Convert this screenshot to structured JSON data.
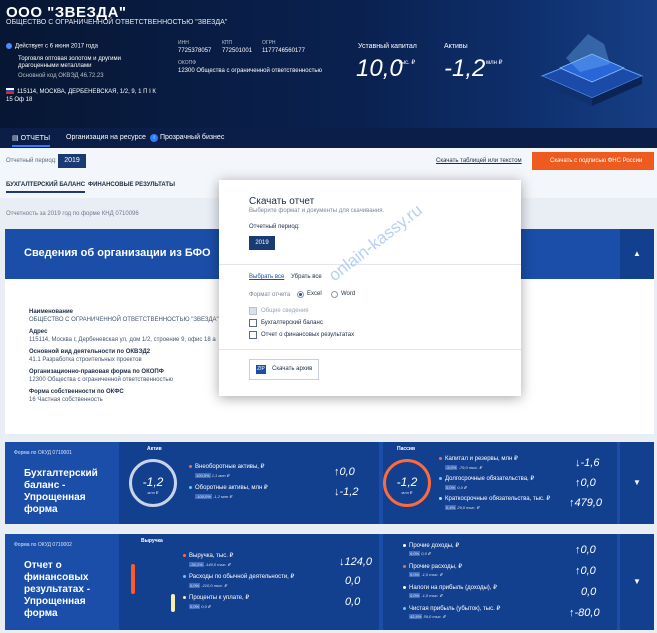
{
  "header": {
    "company_name": "ООО \"ЗВЕЗДА\"",
    "full_name": "ОБЩЕСТВО С ОГРАНИЧЕННОЙ ОТВЕТСТВЕННОСТЬЮ \"ЗВЕЗДА\"",
    "status": "Действует с 6 июня 2017 года",
    "okved_text": "Торговля оптовая золотом и другими драгоценными металлами",
    "okved_code": "Основной код ОКВЭД 46.72.23",
    "address": "115114, МОСКВА, ДЕРБЕНЕВСКАЯ, 1/2, 9, 1 П I К 15 Оф 18",
    "inn_label": "ИНН",
    "inn_value": "7725378057",
    "kpp_label": "КПП",
    "kpp_value": "772501001",
    "ogrn_label": "ОГРН",
    "ogrn_value": "1177746560177",
    "okopf_label": "ОКОПФ",
    "okopf_value": "12300 Общества с ограниченной ответственностью",
    "capital_label": "Уставный капитал",
    "capital_value": "10,0",
    "capital_unit": "тыс. ₽",
    "assets_label": "Активы",
    "assets_value": "-1,2",
    "assets_unit": "млн ₽"
  },
  "tabs": [
    "ОТЧЕТЫ",
    "Организация на ресурсе",
    "Прозрачный бизнес"
  ],
  "toolbar": {
    "period_label": "Отчетный период:",
    "period_value": "2019",
    "download_link": "Скачать таблицей или текстом",
    "signed_button": "Скачать с подписью ФНС России"
  },
  "subtabs": [
    "БУХГАЛТЕРСКИЙ БАЛАНС",
    "ФИНАНСОВЫЕ РЕЗУЛЬТАТЫ"
  ],
  "report_note": "Отчетность за 2019 год по форме КНД 0710096",
  "bfo": {
    "title": "Сведения об организации из БФО",
    "fields": [
      {
        "label": "Наименование",
        "value": "ОБЩЕСТВО С ОГРАНИЧЕННОЙ ОТВЕТСТВЕННОСТЬЮ \"ЗВЕЗДА\""
      },
      {
        "label": "Адрес",
        "value": "115114, Москва г, Дербеневская ул, дом 1/2, строение 9, офис 18 а"
      },
      {
        "label": "Основной вид деятельности по ОКВЭД2",
        "value": "41.1 Разработка строительных проектов"
      },
      {
        "label": "Организационно-правовая форма по ОКОПФ",
        "value": "12300 Общества с ограниченной ответственностью"
      },
      {
        "label": "Форма собственности по ОКФС",
        "value": "16 Частная собственность"
      }
    ]
  },
  "balance_card": {
    "form_label": "Форма по ОКУД 0710001",
    "title": "Бухгалтерский баланс - Упрощенная форма",
    "assets": {
      "title": "Актив",
      "ring_value": "-1,2",
      "ring_unit": "млн ₽",
      "rows": [
        {
          "label": "Внеоборотные активы, ₽",
          "sub": "100,0%",
          "sub2": "1,1 млн ₽",
          "value": "0,0",
          "arrow": "↑"
        },
        {
          "label": "Оборотные активы, млн ₽",
          "sub": "-100,0%",
          "sub2": "-1,2 млн ₽",
          "value": "-1,2",
          "arrow": "↓"
        }
      ]
    },
    "liabilities": {
      "title": "Пассив",
      "ring_value": "-1,2",
      "ring_unit": "млн ₽",
      "rows": [
        {
          "label": "Капитал и резервы, млн ₽",
          "sub": "-5,0%",
          "sub2": "-79,0 тыс. ₽",
          "value": "-1,6",
          "arrow": "↓"
        },
        {
          "label": "Долгосрочные обязательства, ₽",
          "sub": "0,0%",
          "sub2": "0,0 ₽",
          "value": "0,0",
          "arrow": "↑"
        },
        {
          "label": "Краткосрочные обязательства, тыс. ₽",
          "sub": "0,4%",
          "sub2": "29,0 тыс. ₽",
          "value": "479,0",
          "arrow": "↑"
        }
      ]
    }
  },
  "results_card": {
    "form_label": "Форма по ОКУД 0710002",
    "title": "Отчет о финансовых результатах - Упрощенная форма",
    "revenue_title": "Выручка",
    "left_rows": [
      {
        "label": "Выручка, тыс. ₽",
        "sub": "-34,1%",
        "sub2": "-140,0 тыс. ₽",
        "value": "124,0",
        "arrow": "↓"
      },
      {
        "label": "Расходы по обычной деятельности, ₽",
        "sub": "0,0%",
        "sub2": "-210,0 тыс. ₽",
        "value": "0,0",
        "arrow": ""
      },
      {
        "label": "Проценты к уплате, ₽",
        "sub": "0,0%",
        "sub2": "0,0 ₽",
        "value": "0,0",
        "arrow": ""
      }
    ],
    "right_rows": [
      {
        "label": "Прочие доходы, ₽",
        "sub": "0,0%",
        "sub2": "0,0 ₽",
        "value": "0,0",
        "arrow": "↑"
      },
      {
        "label": "Прочие расходы, ₽",
        "sub": "0,0%",
        "sub2": "-1,0 тыс. ₽",
        "value": "0,0",
        "arrow": "↑"
      },
      {
        "label": "Налоги на прибыль (доходы), ₽",
        "sub": "0,0%",
        "sub2": "-1,0 тыс. ₽",
        "value": "0,0",
        "arrow": ""
      },
      {
        "label": "Чистая прибыль (убыток), тыс. ₽",
        "sub": "42,4%",
        "sub2": "59,0 тыс. ₽",
        "value": "-80,0",
        "arrow": "↑"
      }
    ]
  },
  "modal": {
    "title": "Скачать отчет",
    "subtitle": "Выберите формат и документы для скачивания.",
    "period_label": "Отчетный период:",
    "period_value": "2019",
    "select_all": "Выбрать все",
    "deselect_all": "Убрать все",
    "format_label": "Формат отчета",
    "format_excel": "Excel",
    "format_word": "Word",
    "checkboxes": [
      "Общие сведения",
      "Бухгалтерский баланс",
      "Отчет о финансовых результатах"
    ],
    "download_button": "Скачать архив"
  },
  "watermark": "onlain-kassy.ru"
}
